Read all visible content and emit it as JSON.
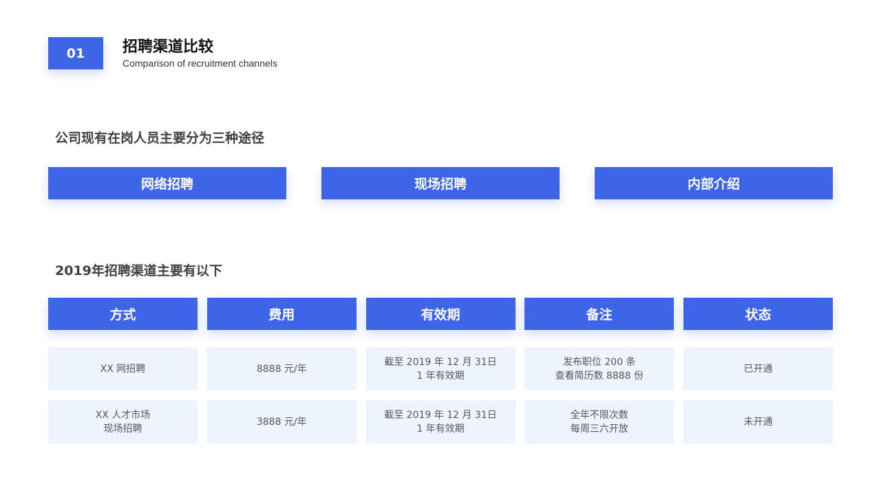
{
  "header": {
    "number": "01",
    "title": "招聘渠道比较",
    "subtitle": "Comparison of recruitment channels"
  },
  "section1": {
    "heading": "公司现有在岗人员主要分为三种途径",
    "channels": [
      "网络招聘",
      "现场招聘",
      "内部介绍"
    ]
  },
  "section2": {
    "heading": "2019年招聘渠道主要有以下",
    "table": {
      "headers": [
        "方式",
        "费用",
        "有效期",
        "备注",
        "状态"
      ],
      "rows": [
        [
          [
            "XX 网招聘"
          ],
          [
            "8888 元/年"
          ],
          [
            "截至 2019 年 12 月 31日",
            "1 年有效期"
          ],
          [
            "发布职位 200 条",
            "查看简历数 8888 份"
          ],
          [
            "已开通"
          ]
        ],
        [
          [
            "XX 人才市场",
            "现场招聘"
          ],
          [
            "3888 元/年"
          ],
          [
            "截至 2019 年 12 月 31日",
            "1 年有效期"
          ],
          [
            "全年不限次数",
            "每周三六开放"
          ],
          [
            "未开通"
          ]
        ]
      ]
    }
  },
  "colors": {
    "accent": "#3e65e8",
    "cell_background": "#eef4fe",
    "heading_text": "#404040"
  }
}
